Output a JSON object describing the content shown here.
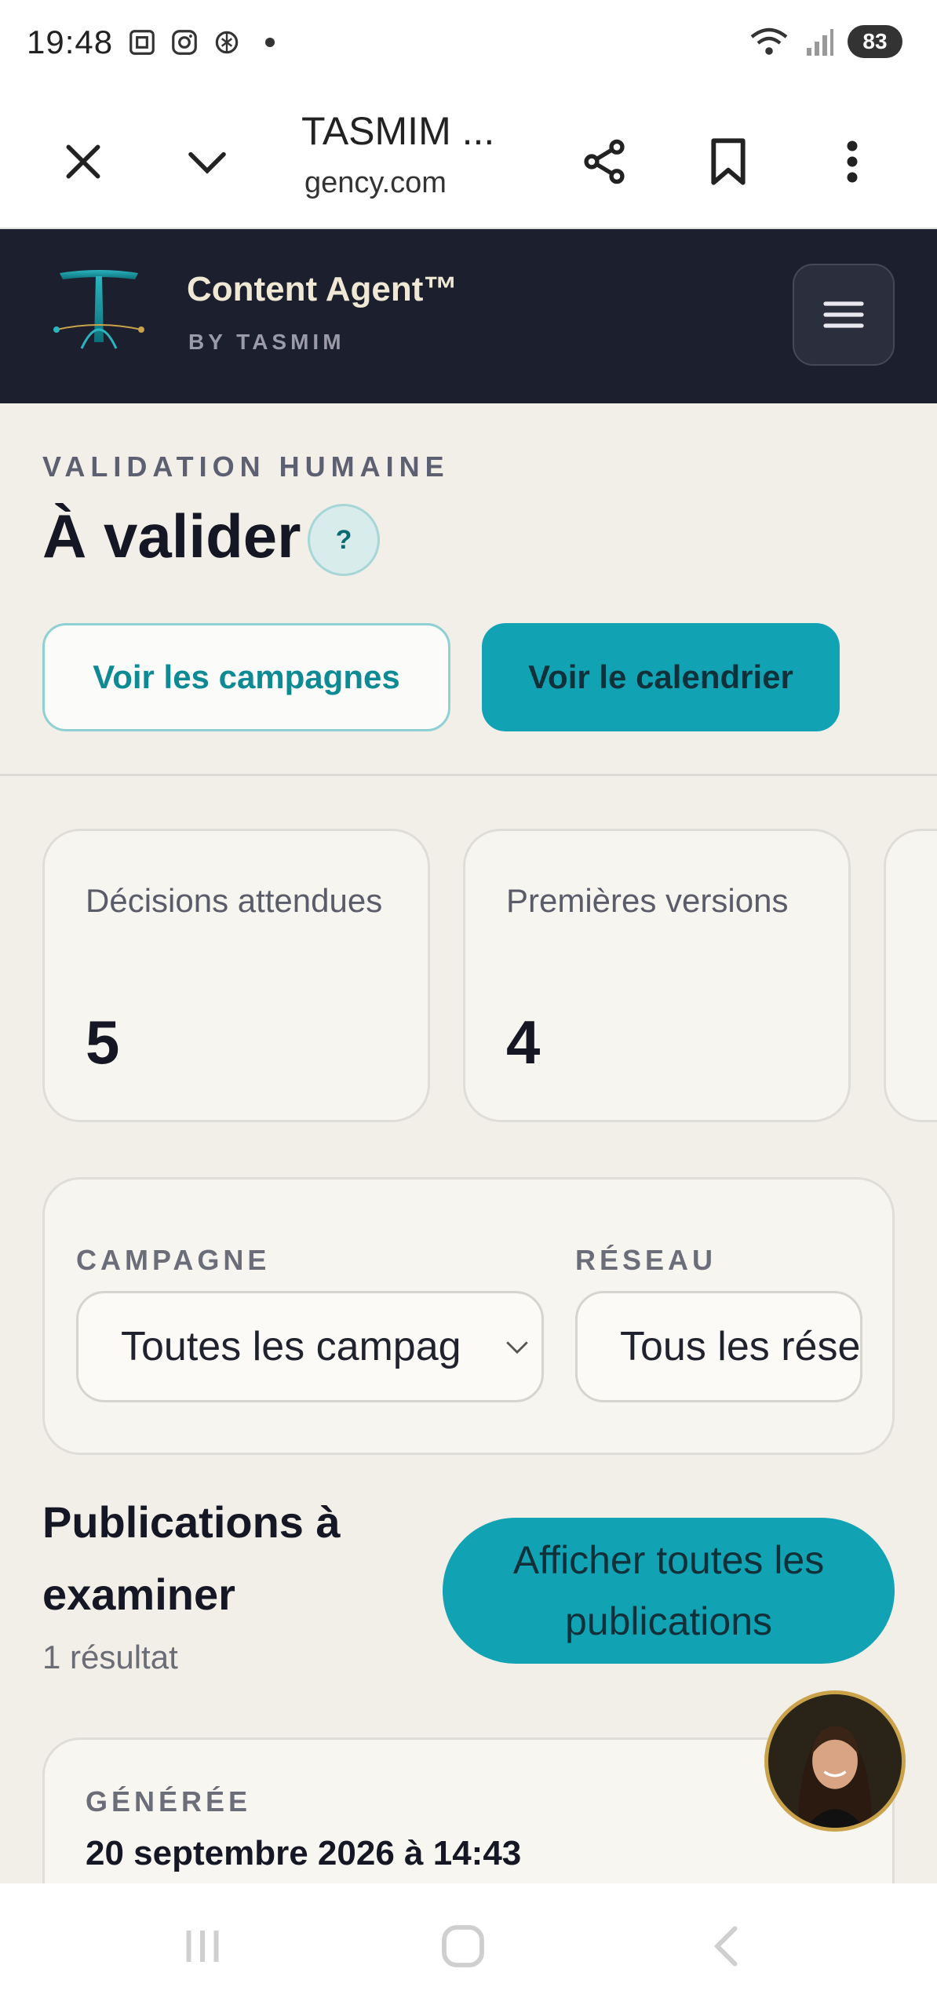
{
  "status_bar": {
    "time": "19:48",
    "battery": "83",
    "left_icons": [
      "screenshot-icon",
      "instagram-icon",
      "chatgpt-icon",
      "notification-dot"
    ],
    "right_icons": [
      "wifi-icon",
      "signal-icon",
      "battery-icon"
    ]
  },
  "browser": {
    "title": "TASMIM ...",
    "url": "gency.com",
    "icons": [
      "close-icon",
      "chevron-down-icon",
      "share-icon",
      "bookmark-icon",
      "more-vert-icon"
    ]
  },
  "app_header": {
    "brand_name": "Content Agent™",
    "brand_sub": "BY TASMIM",
    "menu_icon": "hamburger-icon"
  },
  "page": {
    "eyebrow": "VALIDATION HUMAINE",
    "title": "À valider",
    "help_label": "?",
    "btn_campaigns": "Voir les campagnes",
    "btn_calendar": "Voir le calendrier"
  },
  "stats": [
    {
      "label": "Décisions attendues",
      "value": "5"
    },
    {
      "label": "Premières versions",
      "value": "4"
    }
  ],
  "filters": {
    "campaign_label": "CAMPAGNE",
    "campaign_value": "Toutes les campag",
    "network_label": "RÉSEAU",
    "network_value": "Tous les rése"
  },
  "publications": {
    "section_title": "Publications à examiner",
    "result_count": "1 résultat",
    "show_all": "Afficher toutes les publications",
    "card_label": "GÉNÉRÉE",
    "card_date": "20 septembre 2026 à 14:43"
  },
  "colors": {
    "header_bg": "#1c1f2e",
    "accent": "#11a3b3",
    "content_bg": "#f2efe8"
  }
}
